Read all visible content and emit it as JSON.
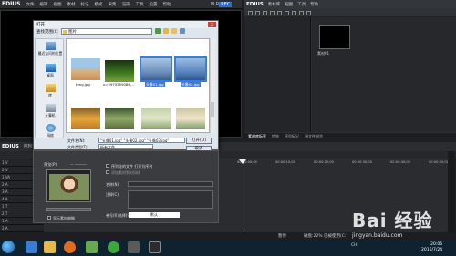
{
  "main_menu": {
    "logo": "EDIUS",
    "items": [
      "文件",
      "编辑",
      "视图",
      "素材",
      "标记",
      "模式",
      "采集",
      "渲染",
      "工具",
      "设置",
      "帮助"
    ],
    "plr": {
      "p": "PLR",
      "rec": "REC"
    }
  },
  "bin_window": {
    "logo": "EDIUS",
    "menu": [
      "素材库",
      "视图",
      "工具",
      "帮助"
    ],
    "clip_label": "素材01",
    "tabs": [
      "素材库标签",
      "特效",
      "序列标记",
      "源文件浏览"
    ]
  },
  "timeline": {
    "logo": "EDIUS",
    "title": "序列1",
    "ruler": [
      "00:00:00;00",
      "00:00:10;00",
      "00:00:20;00",
      "00:00:30;00",
      "00:00:40;00",
      "00:00:50;00"
    ],
    "tracks": [
      "1 V",
      "2 V",
      "1 VA",
      "2 A",
      "3 A",
      "4 A",
      "1 T",
      "2 T",
      "1 A",
      "2 A"
    ]
  },
  "status_bar": {
    "mode": "暂停",
    "disk": "磁盘:22% 已被使用(C:)"
  },
  "open_dialog": {
    "title": "打开",
    "lookin_label": "查找范围(I):",
    "lookin_value": "图片",
    "places": [
      "最近访问的位置",
      "桌面",
      "库",
      "计算机",
      "网络"
    ],
    "files": [
      {
        "name": "timg.jpg",
        "selected": false
      },
      {
        "name": "u=2975559086,...",
        "selected": false
      },
      {
        "name": "头像01.jpg",
        "selected": true
      },
      {
        "name": "头像02.jpg",
        "selected": true
      },
      {
        "name": "",
        "selected": false
      },
      {
        "name": "",
        "selected": false
      },
      {
        "name": "",
        "selected": false
      },
      {
        "name": "",
        "selected": false
      }
    ],
    "filename_label": "文件名(N):",
    "filename_value": "\"头像01.jpg\" \"头像02.jpg\" \"头像03.jpg\"",
    "filetype_label": "文件类型(T):",
    "filetype_value": "所有文件",
    "open_button": "打开(O)",
    "cancel_button": "取消",
    "preview_label": "预览(P)",
    "preview_header": "-- ---------",
    "checkbox_sequence": "序列化的文件 打开为序列",
    "checkbox_clip": "添加素材到时间线",
    "name_label": "名称(N)",
    "comment_label": "注释(C)",
    "checkbox_show": "显示素材缩略",
    "reel_label": "卷号(R)选择(S)",
    "reel_button": "默认"
  },
  "taskbar": {
    "tray": "CH",
    "time": "20:06",
    "date": "2016/7/24"
  },
  "watermark": {
    "logo": "Bai 经验",
    "url": "jingyan.baidu.com"
  },
  "colors": {
    "accent": "#3c7bd6",
    "playhead": "#4ad9c4",
    "plr_blue": "#2a6ed1"
  }
}
